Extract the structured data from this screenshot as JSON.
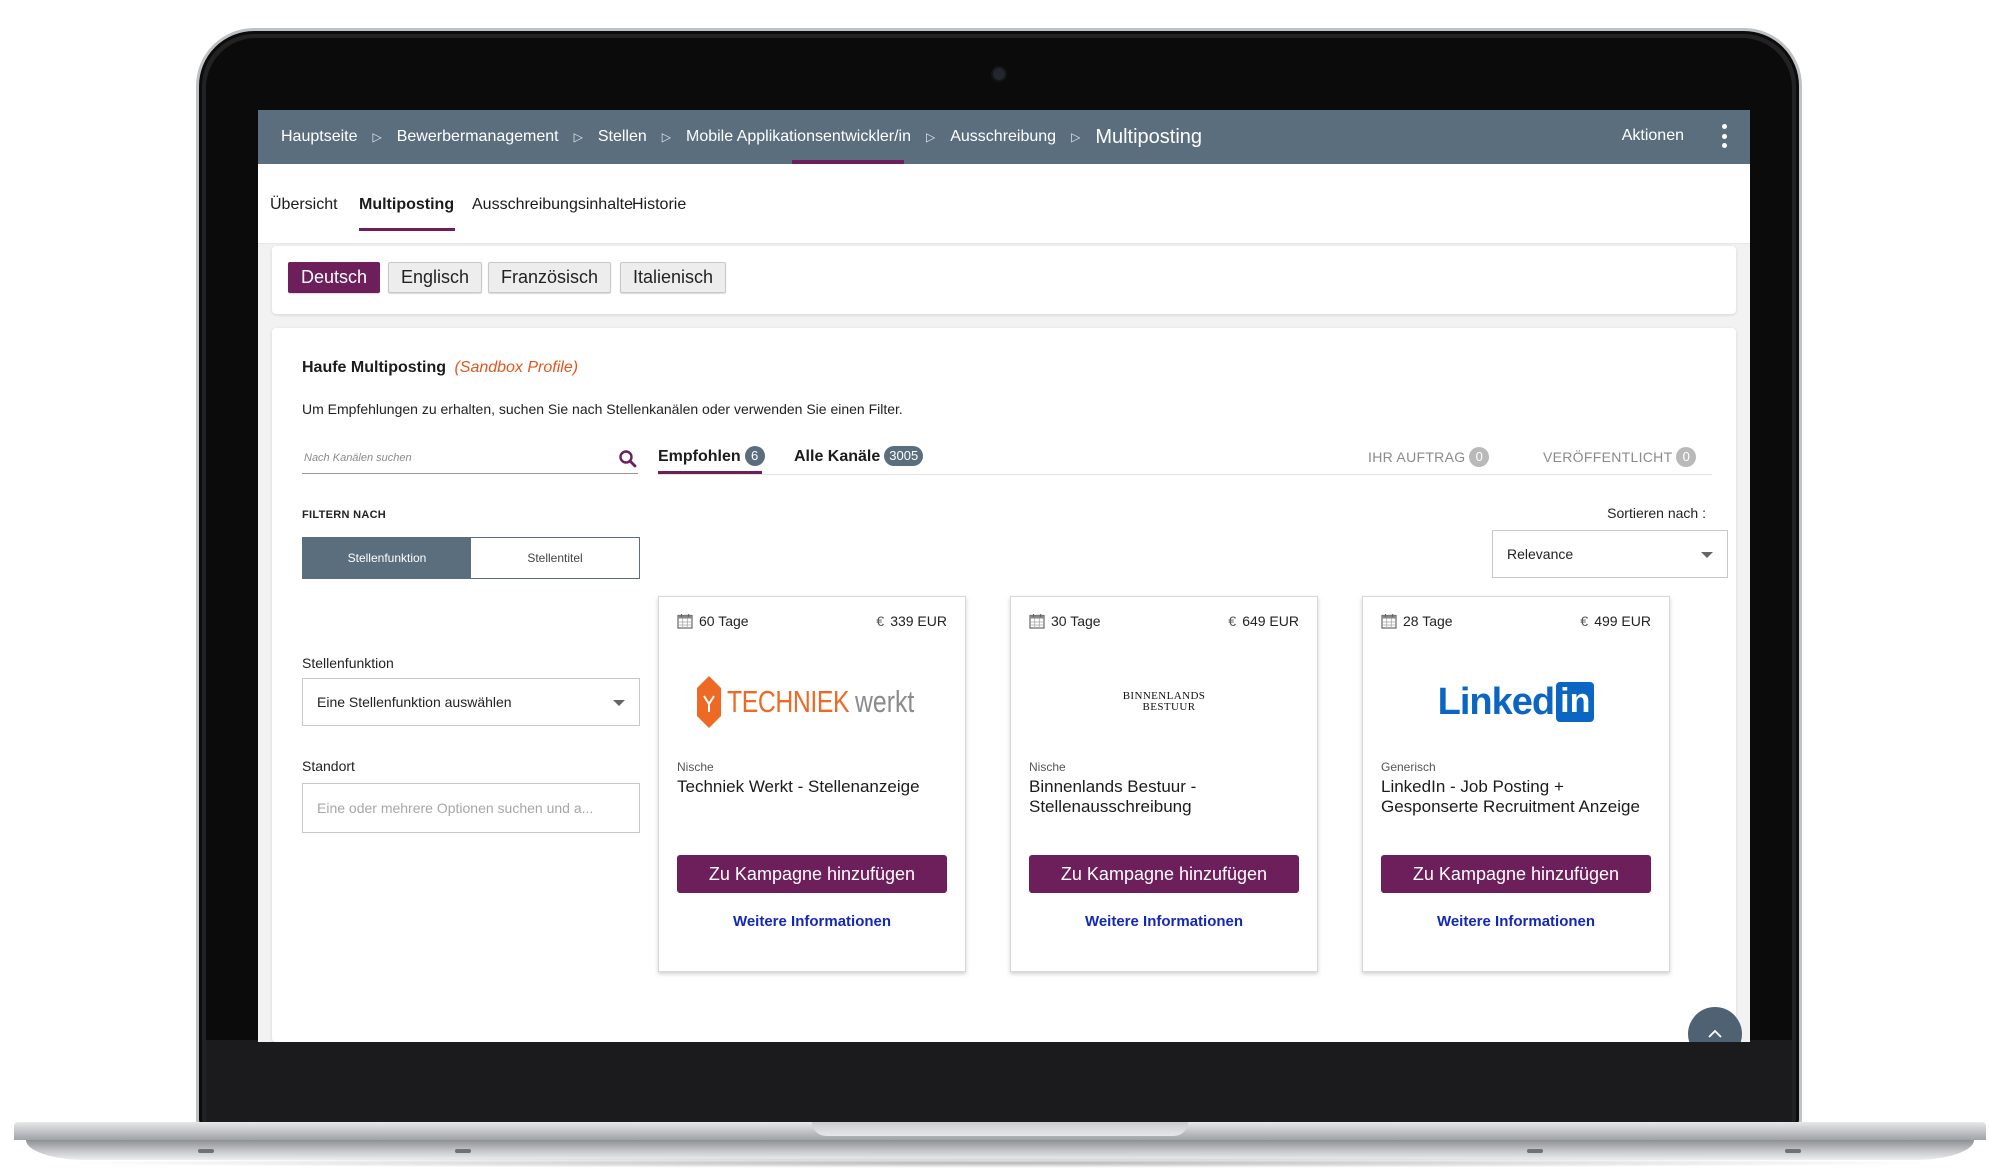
{
  "breadcrumb": {
    "items": [
      "Hauptseite",
      "Bewerbermanagement",
      "Stellen",
      "Mobile Applikationsentwickler/in",
      "Ausschreibung"
    ],
    "current": "Multiposting",
    "separator": "▷"
  },
  "header": {
    "actions_label": "Aktionen"
  },
  "tabs": [
    "Übersicht",
    "Multiposting",
    "Ausschreibungsinhalte",
    "Historie"
  ],
  "languages": [
    "Deutsch",
    "Englisch",
    "Französisch",
    "Italienisch"
  ],
  "section": {
    "title": "Haufe Multiposting",
    "sandbox": "(Sandbox Profile)",
    "hint": "Um Empfehlungen zu erhalten, suchen Sie nach Stellenkanälen oder verwenden Sie einen Filter."
  },
  "search": {
    "placeholder": "Nach Kanälen suchen"
  },
  "filter": {
    "label": "FILTERN NACH",
    "segments": [
      "Stellenfunktion",
      "Stellentitel"
    ],
    "function_label": "Stellenfunktion",
    "function_value": "Eine Stellenfunktion auswählen",
    "location_label": "Standort",
    "location_placeholder": "Eine oder mehrere Optionen suchen und a..."
  },
  "channel_tabs": {
    "recommended": {
      "label": "Empfohlen",
      "count": "6"
    },
    "all": {
      "label": "Alle Kanäle",
      "count": "3005"
    },
    "order": {
      "label": "IHR AUFTRAG",
      "count": "0"
    },
    "published": {
      "label": "VERÖFFENTLICHT",
      "count": "0"
    }
  },
  "sort": {
    "label": "Sortieren nach :",
    "value": "Relevance"
  },
  "cards": [
    {
      "duration": "60 Tage",
      "currency_symbol": "€",
      "price": "339 EUR",
      "logo_text_a": "TECHNIEK",
      "logo_text_b": "werkt",
      "category": "Nische",
      "title": "Techniek Werkt - Stellenanzeige",
      "button": "Zu Kampagne hinzufügen",
      "link": "Weitere Informationen"
    },
    {
      "duration": "30 Tage",
      "currency_symbol": "€",
      "price": "649 EUR",
      "logo_text_a": "BINNENLANDS",
      "logo_text_b": "BESTUUR",
      "category": "Nische",
      "title": "Binnenlands Bestuur - Stellenausschreibung",
      "button": "Zu Kampagne hinzufügen",
      "link": "Weitere Informationen"
    },
    {
      "duration": "28 Tage",
      "currency_symbol": "€",
      "price": "499 EUR",
      "logo_text_a": "Linked",
      "logo_text_b": "in",
      "category": "Generisch",
      "title": "LinkedIn - Job Posting + Gesponserte Recruitment Anzeige",
      "button": "Zu Kampagne hinzufügen",
      "link": "Weitere Informationen"
    }
  ],
  "colors": {
    "accent": "#6d1f5b",
    "header": "#5b6e7e",
    "link": "#1428b8",
    "sandbox": "#e2561e",
    "techniek_orange": "#ee6a24",
    "linkedin_blue": "#0a66c2"
  },
  "icons": {
    "search": "search-icon",
    "calendar": "calendar-icon",
    "more": "more-vertical-icon",
    "scroll_top": "chevron-up-icon"
  }
}
